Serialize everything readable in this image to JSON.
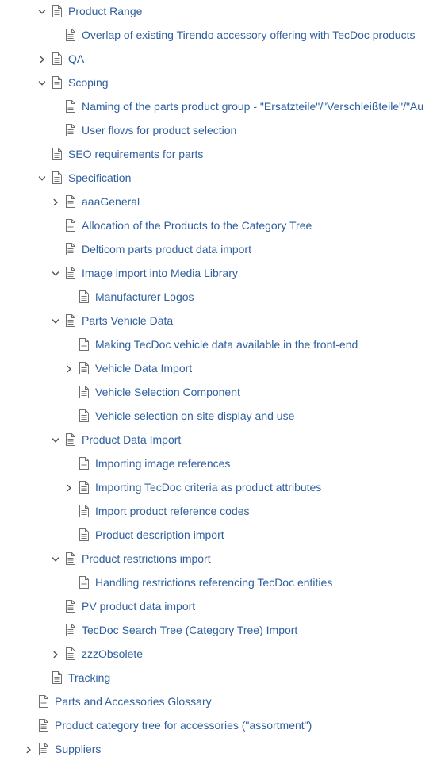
{
  "tree": {
    "nodes": [
      {
        "label": "Product Range",
        "level": 2,
        "toggle": "expanded",
        "icon": "page-icon"
      },
      {
        "label": "Overlap of existing Tirendo accessory offering with TecDoc products",
        "level": 3,
        "toggle": "none",
        "icon": "page-icon"
      },
      {
        "label": "QA",
        "level": 2,
        "toggle": "collapsed",
        "icon": "page-icon"
      },
      {
        "label": "Scoping",
        "level": 2,
        "toggle": "expanded",
        "icon": "page-icon"
      },
      {
        "label": "Naming of the parts product group - \"Ersatzteile\"/\"Verschleißteile\"/\"Au",
        "level": 3,
        "toggle": "none",
        "icon": "page-icon"
      },
      {
        "label": "User flows for product selection",
        "level": 3,
        "toggle": "none",
        "icon": "page-icon"
      },
      {
        "label": "SEO requirements for parts",
        "level": 2,
        "toggle": "none",
        "icon": "page-icon"
      },
      {
        "label": "Specification",
        "level": 2,
        "toggle": "expanded",
        "icon": "page-icon"
      },
      {
        "label": "aaaGeneral",
        "level": 3,
        "toggle": "collapsed",
        "icon": "page-icon"
      },
      {
        "label": "Allocation of the Products to the Category Tree",
        "level": 3,
        "toggle": "none",
        "icon": "page-icon"
      },
      {
        "label": "Delticom parts product data import",
        "level": 3,
        "toggle": "none",
        "icon": "page-icon"
      },
      {
        "label": "Image import into Media Library",
        "level": 3,
        "toggle": "expanded",
        "icon": "page-icon"
      },
      {
        "label": "Manufacturer Logos",
        "level": 4,
        "toggle": "none",
        "icon": "page-icon"
      },
      {
        "label": "Parts Vehicle Data",
        "level": 3,
        "toggle": "expanded",
        "icon": "page-icon"
      },
      {
        "label": "Making TecDoc vehicle data available in the front-end",
        "level": 4,
        "toggle": "none",
        "icon": "page-icon"
      },
      {
        "label": "Vehicle Data Import",
        "level": 4,
        "toggle": "collapsed",
        "icon": "page-icon"
      },
      {
        "label": "Vehicle Selection Component",
        "level": 4,
        "toggle": "none",
        "icon": "page-icon"
      },
      {
        "label": "Vehicle selection on-site display and use",
        "level": 4,
        "toggle": "none",
        "icon": "page-icon"
      },
      {
        "label": "Product Data Import",
        "level": 3,
        "toggle": "expanded",
        "icon": "page-icon"
      },
      {
        "label": "Importing image references",
        "level": 4,
        "toggle": "none",
        "icon": "page-icon"
      },
      {
        "label": "Importing TecDoc criteria as product attributes",
        "level": 4,
        "toggle": "collapsed",
        "icon": "page-icon"
      },
      {
        "label": "Import product reference codes",
        "level": 4,
        "toggle": "none",
        "icon": "page-icon"
      },
      {
        "label": "Product description import",
        "level": 4,
        "toggle": "none",
        "icon": "page-icon"
      },
      {
        "label": "Product restrictions import",
        "level": 3,
        "toggle": "expanded",
        "icon": "page-icon"
      },
      {
        "label": "Handling restrictions referencing TecDoc entities",
        "level": 4,
        "toggle": "none",
        "icon": "page-icon"
      },
      {
        "label": "PV product data import",
        "level": 3,
        "toggle": "none",
        "icon": "page-icon"
      },
      {
        "label": "TecDoc Search Tree (Category Tree) Import",
        "level": 3,
        "toggle": "none",
        "icon": "page-icon"
      },
      {
        "label": "zzzObsolete",
        "level": 3,
        "toggle": "collapsed",
        "icon": "page-icon"
      },
      {
        "label": "Tracking",
        "level": 2,
        "toggle": "none",
        "icon": "page-icon"
      },
      {
        "label": "Parts and Accessories Glossary",
        "level": 1,
        "toggle": "none",
        "icon": "page-icon"
      },
      {
        "label": "Product category tree for accessories (\"assortment\")",
        "level": 1,
        "toggle": "none",
        "icon": "page-icon"
      },
      {
        "label": "Suppliers",
        "level": 1,
        "toggle": "collapsed",
        "icon": "page-icon"
      }
    ]
  },
  "colors": {
    "link": "#2f5f9f",
    "icon_stroke": "#707070",
    "toggle": "#505050",
    "background": "#ffffff"
  }
}
